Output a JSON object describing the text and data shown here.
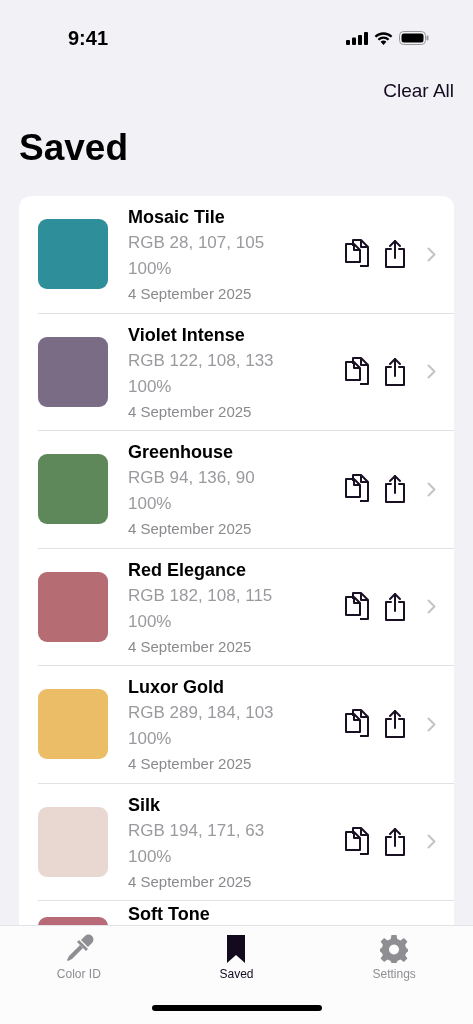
{
  "status_bar": {
    "time": "9:41"
  },
  "header": {
    "action": "Clear All",
    "title": "Saved"
  },
  "colors": [
    {
      "name": "Mosaic Tile",
      "color": "#2e8f9a",
      "rgb": "RGB 28, 107, 105",
      "opacity": "100%",
      "date": "4 September 2025"
    },
    {
      "name": "Violet Intense",
      "color": "#7a6c85",
      "rgb": "RGB 122, 108, 133",
      "opacity": "100%",
      "date": "4 September 2025"
    },
    {
      "name": "Greenhouse",
      "color": "#5e885a",
      "rgb": "RGB 94, 136, 90",
      "opacity": "100%",
      "date": "4 September 2025"
    },
    {
      "name": "Red Elegance",
      "color": "#b66c73",
      "rgb": "RGB 182, 108, 115",
      "opacity": "100%",
      "date": "4 September 2025"
    },
    {
      "name": "Luxor Gold",
      "color": "#ebbd67",
      "rgb": "RGB 289, 184, 103",
      "opacity": "100%",
      "date": "4 September 2025"
    },
    {
      "name": "Silk",
      "color": "#e9d8d2",
      "rgb": "RGB 194, 171, 63",
      "opacity": "100%",
      "date": "4 September 2025"
    },
    {
      "name": "Soft Tone",
      "color": "#b86a78"
    }
  ],
  "tab_bar": [
    {
      "label": "Color ID",
      "kind": "dropper",
      "selected": false
    },
    {
      "label": "Saved",
      "kind": "bookmark",
      "selected": true
    },
    {
      "label": "Settings",
      "kind": "gear",
      "selected": false
    }
  ]
}
